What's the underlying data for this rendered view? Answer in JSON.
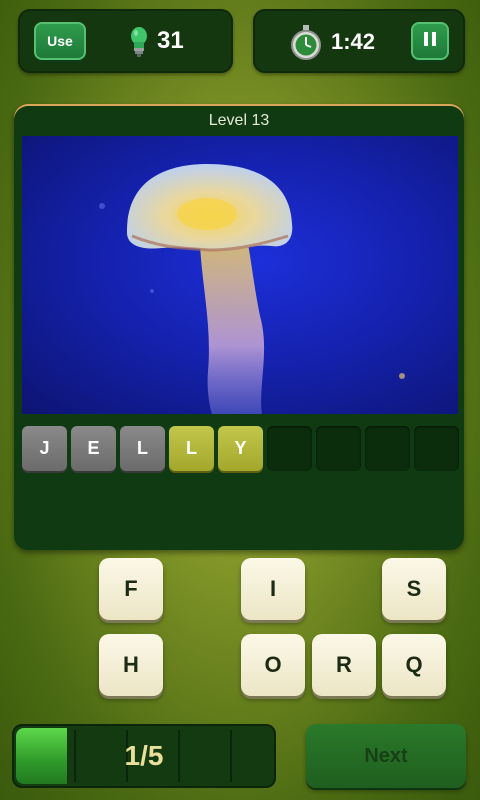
{
  "hints": {
    "use_label": "Use",
    "count": "31",
    "icon": "lightbulb-icon"
  },
  "timer": {
    "value": "1:42",
    "icon": "stopwatch-icon",
    "pause_icon": "pause-icon"
  },
  "level": {
    "title": "Level 13"
  },
  "image": {
    "subject": "jellyfish"
  },
  "answer": {
    "slots": [
      {
        "letter": "J",
        "state": "filled"
      },
      {
        "letter": "E",
        "state": "filled"
      },
      {
        "letter": "L",
        "state": "filled"
      },
      {
        "letter": "L",
        "state": "hinted"
      },
      {
        "letter": "Y",
        "state": "hinted"
      },
      {
        "letter": "",
        "state": "empty"
      },
      {
        "letter": "",
        "state": "empty"
      },
      {
        "letter": "",
        "state": "empty"
      },
      {
        "letter": "",
        "state": "empty"
      }
    ]
  },
  "letters": [
    "F",
    "I",
    "S",
    "H",
    "O",
    "R",
    "Q"
  ],
  "progress": {
    "label": "1/5",
    "current": 1,
    "total": 5
  },
  "next": {
    "label": "Next"
  },
  "colors": {
    "accent": "#2e9a2a",
    "hint_slot": "#b7bc3e",
    "card": "#0f3a12"
  }
}
